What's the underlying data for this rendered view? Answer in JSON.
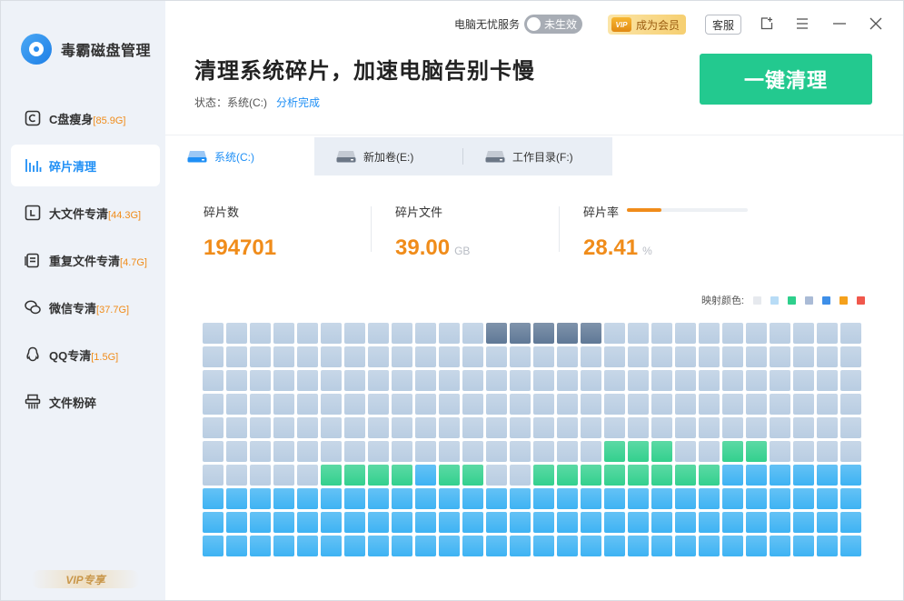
{
  "app": {
    "name": "毒霸磁盘管理",
    "vip_footer": "VIP专享"
  },
  "sidebar": {
    "items": [
      {
        "label": "C盘瘦身",
        "badge": "[85.9G]",
        "icon": "drive-c-icon",
        "active": false
      },
      {
        "label": "碎片清理",
        "badge": "",
        "icon": "fragment-bars-icon",
        "active": true
      },
      {
        "label": "大文件专清",
        "badge": "[44.3G]",
        "icon": "large-file-icon",
        "active": false
      },
      {
        "label": "重复文件专清",
        "badge": "[4.7G]",
        "icon": "duplicate-file-icon",
        "active": false
      },
      {
        "label": "微信专清",
        "badge": "[37.7G]",
        "icon": "wechat-icon",
        "active": false
      },
      {
        "label": "QQ专清",
        "badge": "[1.5G]",
        "icon": "qq-icon",
        "active": false
      },
      {
        "label": "文件粉碎",
        "badge": "",
        "icon": "shredder-icon",
        "active": false
      }
    ]
  },
  "titlebar": {
    "service_label": "电脑无忧服务",
    "service_toggle_text": "未生效",
    "vip_button": "成为会员",
    "vip_crown_text": "VIP",
    "customer_service": "客服"
  },
  "header": {
    "title": "清理系统碎片，加速电脑告别卡慢",
    "status_label": "状态：",
    "status_value": "系统(C:)",
    "status_done": "分析完成",
    "clean_button": "一键清理"
  },
  "tabs": [
    {
      "label": "系统(C:)",
      "active": true
    },
    {
      "label": "新加卷(E:)",
      "active": false
    },
    {
      "label": "工作目录(F:)",
      "active": false
    }
  ],
  "stats": {
    "fragment_count_label": "碎片数",
    "fragment_count_value": "194701",
    "fragment_file_label": "碎片文件",
    "fragment_file_value": "39.00",
    "fragment_file_unit": "GB",
    "fragment_rate_label": "碎片率",
    "fragment_rate_value": "28.41",
    "fragment_rate_unit": "%",
    "fragment_rate_fraction": 0.2841
  },
  "legend": {
    "label": "映射颜色:",
    "colors": [
      "#e6e9ee",
      "#b8dcf6",
      "#2ecf8c",
      "#aabbd6",
      "#3e8fe8",
      "#f5a11c",
      "#f0584c"
    ]
  },
  "map": {
    "columns": 28,
    "rows": 10,
    "rows_data": [
      "GGGGGGGGGGGGDDDDDGGGGGGGGGGG",
      "GGGGGGGGGGGGGGGGGGGGGGGGGGGG",
      "GGGGGGGGGGGGGGGGGGGGGGGGGGGG",
      "GGGGGGGGGGGGGGGGGGGGGGGGGGGG",
      "GGGGGGGGGGGGGGGGGGGGGGGGGGGG",
      "GGGGGGGGGGGGGGGGGNNNGGNNGGGG",
      "GGGGGNNNNBNNGGNNNNNNNNBBBBBB",
      "BBBBBBBBBBBBBBBBBBBBBBBBBBBB",
      "BBBBBBBBBBBBBBBBBBBBBBBBBBBB",
      "BBBBBBBBBBBBBBBBBBBBBBBBBBBB"
    ],
    "colors": {
      "G": "#b9cde2",
      "D": "#5f7896",
      "N": "#33d08e",
      "B": "#3eb3f3"
    }
  }
}
